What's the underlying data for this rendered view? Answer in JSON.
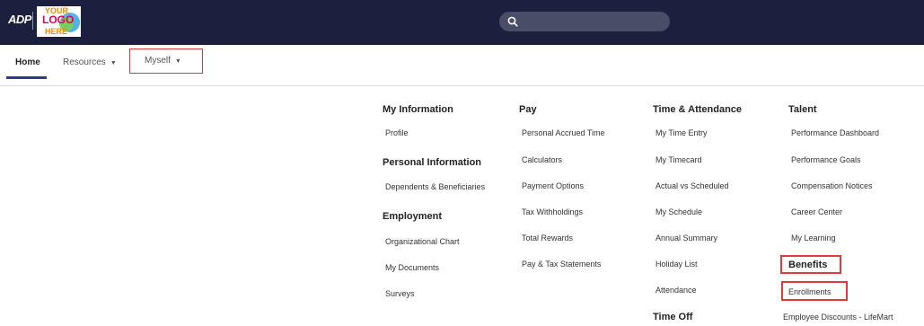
{
  "header": {
    "brand": "ADP",
    "company_logo_text": [
      "YOUR",
      "LOGO",
      "HERE"
    ],
    "search_placeholder": ""
  },
  "nav": {
    "home": "Home",
    "resources": "Resources",
    "myself": "Myself",
    "caret": "▼"
  },
  "menu": {
    "my_information": {
      "heading": "My Information",
      "items": [
        "Profile"
      ]
    },
    "personal_information": {
      "heading": "Personal Information",
      "items": [
        "Dependents & Beneficiaries"
      ]
    },
    "employment": {
      "heading": "Employment",
      "items": [
        "Organizational Chart",
        "My Documents",
        "Surveys"
      ]
    },
    "pay": {
      "heading": "Pay",
      "items": [
        "Personal Accrued Time",
        "Calculators",
        "Payment Options",
        "Tax Withholdings",
        "Total Rewards",
        "Pay & Tax Statements"
      ]
    },
    "time_attendance": {
      "heading": "Time & Attendance",
      "items": [
        "My Time Entry",
        "My Timecard",
        "Actual vs Scheduled",
        "My Schedule",
        "Annual Summary",
        "Holiday List",
        "Attendance"
      ]
    },
    "time_off": {
      "heading": "Time Off"
    },
    "talent": {
      "heading": "Talent",
      "items": [
        "Performance Dashboard",
        "Performance Goals",
        "Compensation Notices",
        "Career Center",
        "My Learning"
      ]
    },
    "benefits": {
      "heading": "Benefits",
      "items": [
        "Enrollments",
        "Employee Discounts - LifeMart"
      ]
    }
  },
  "colors": {
    "header_bg": "#1c1f3e",
    "highlight": "#e03a3a",
    "active_underline": "#2b3a8c"
  }
}
